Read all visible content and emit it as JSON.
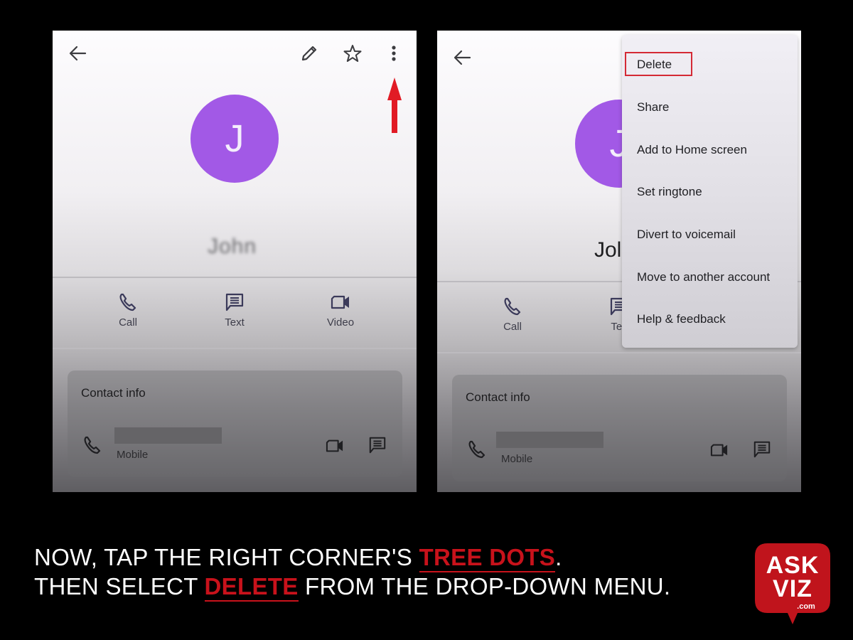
{
  "left_screen": {
    "avatar_initial": "J",
    "contact_name": "John",
    "actions": [
      {
        "label": "Call",
        "icon": "phone-icon"
      },
      {
        "label": "Text",
        "icon": "message-icon"
      },
      {
        "label": "Video",
        "icon": "video-icon"
      }
    ],
    "contact_info": {
      "title": "Contact info",
      "phone_type": "Mobile"
    }
  },
  "right_screen": {
    "avatar_initial": "J",
    "contact_name_partial": "Jol",
    "actions": [
      {
        "label": "Call",
        "icon": "phone-icon"
      },
      {
        "label": "Tex",
        "icon": "message-icon"
      }
    ],
    "contact_info": {
      "title": "Contact info",
      "phone_type": "Mobile"
    },
    "menu": {
      "items": [
        "Delete",
        "Share",
        "Add to Home screen",
        "Set ringtone",
        "Divert to voicemail",
        "Move to another account",
        "Help & feedback"
      ],
      "highlighted": "Delete"
    }
  },
  "caption": {
    "line1_pre": "NOW, TAP THE RIGHT CORNER'S ",
    "line1_em": "TREE DOTS",
    "line1_post": ".",
    "line2_pre": "THEN SELECT ",
    "line2_em": "DELETE",
    "line2_post": " FROM THE DROP-DOWN MENU."
  },
  "logo": {
    "line1": "ASK",
    "line2": "VIZ",
    "line3": ".com"
  },
  "colors": {
    "avatar": "#a259e6",
    "accent_red": "#c8121b",
    "highlight_box": "#d42a35",
    "background": "#000000"
  }
}
